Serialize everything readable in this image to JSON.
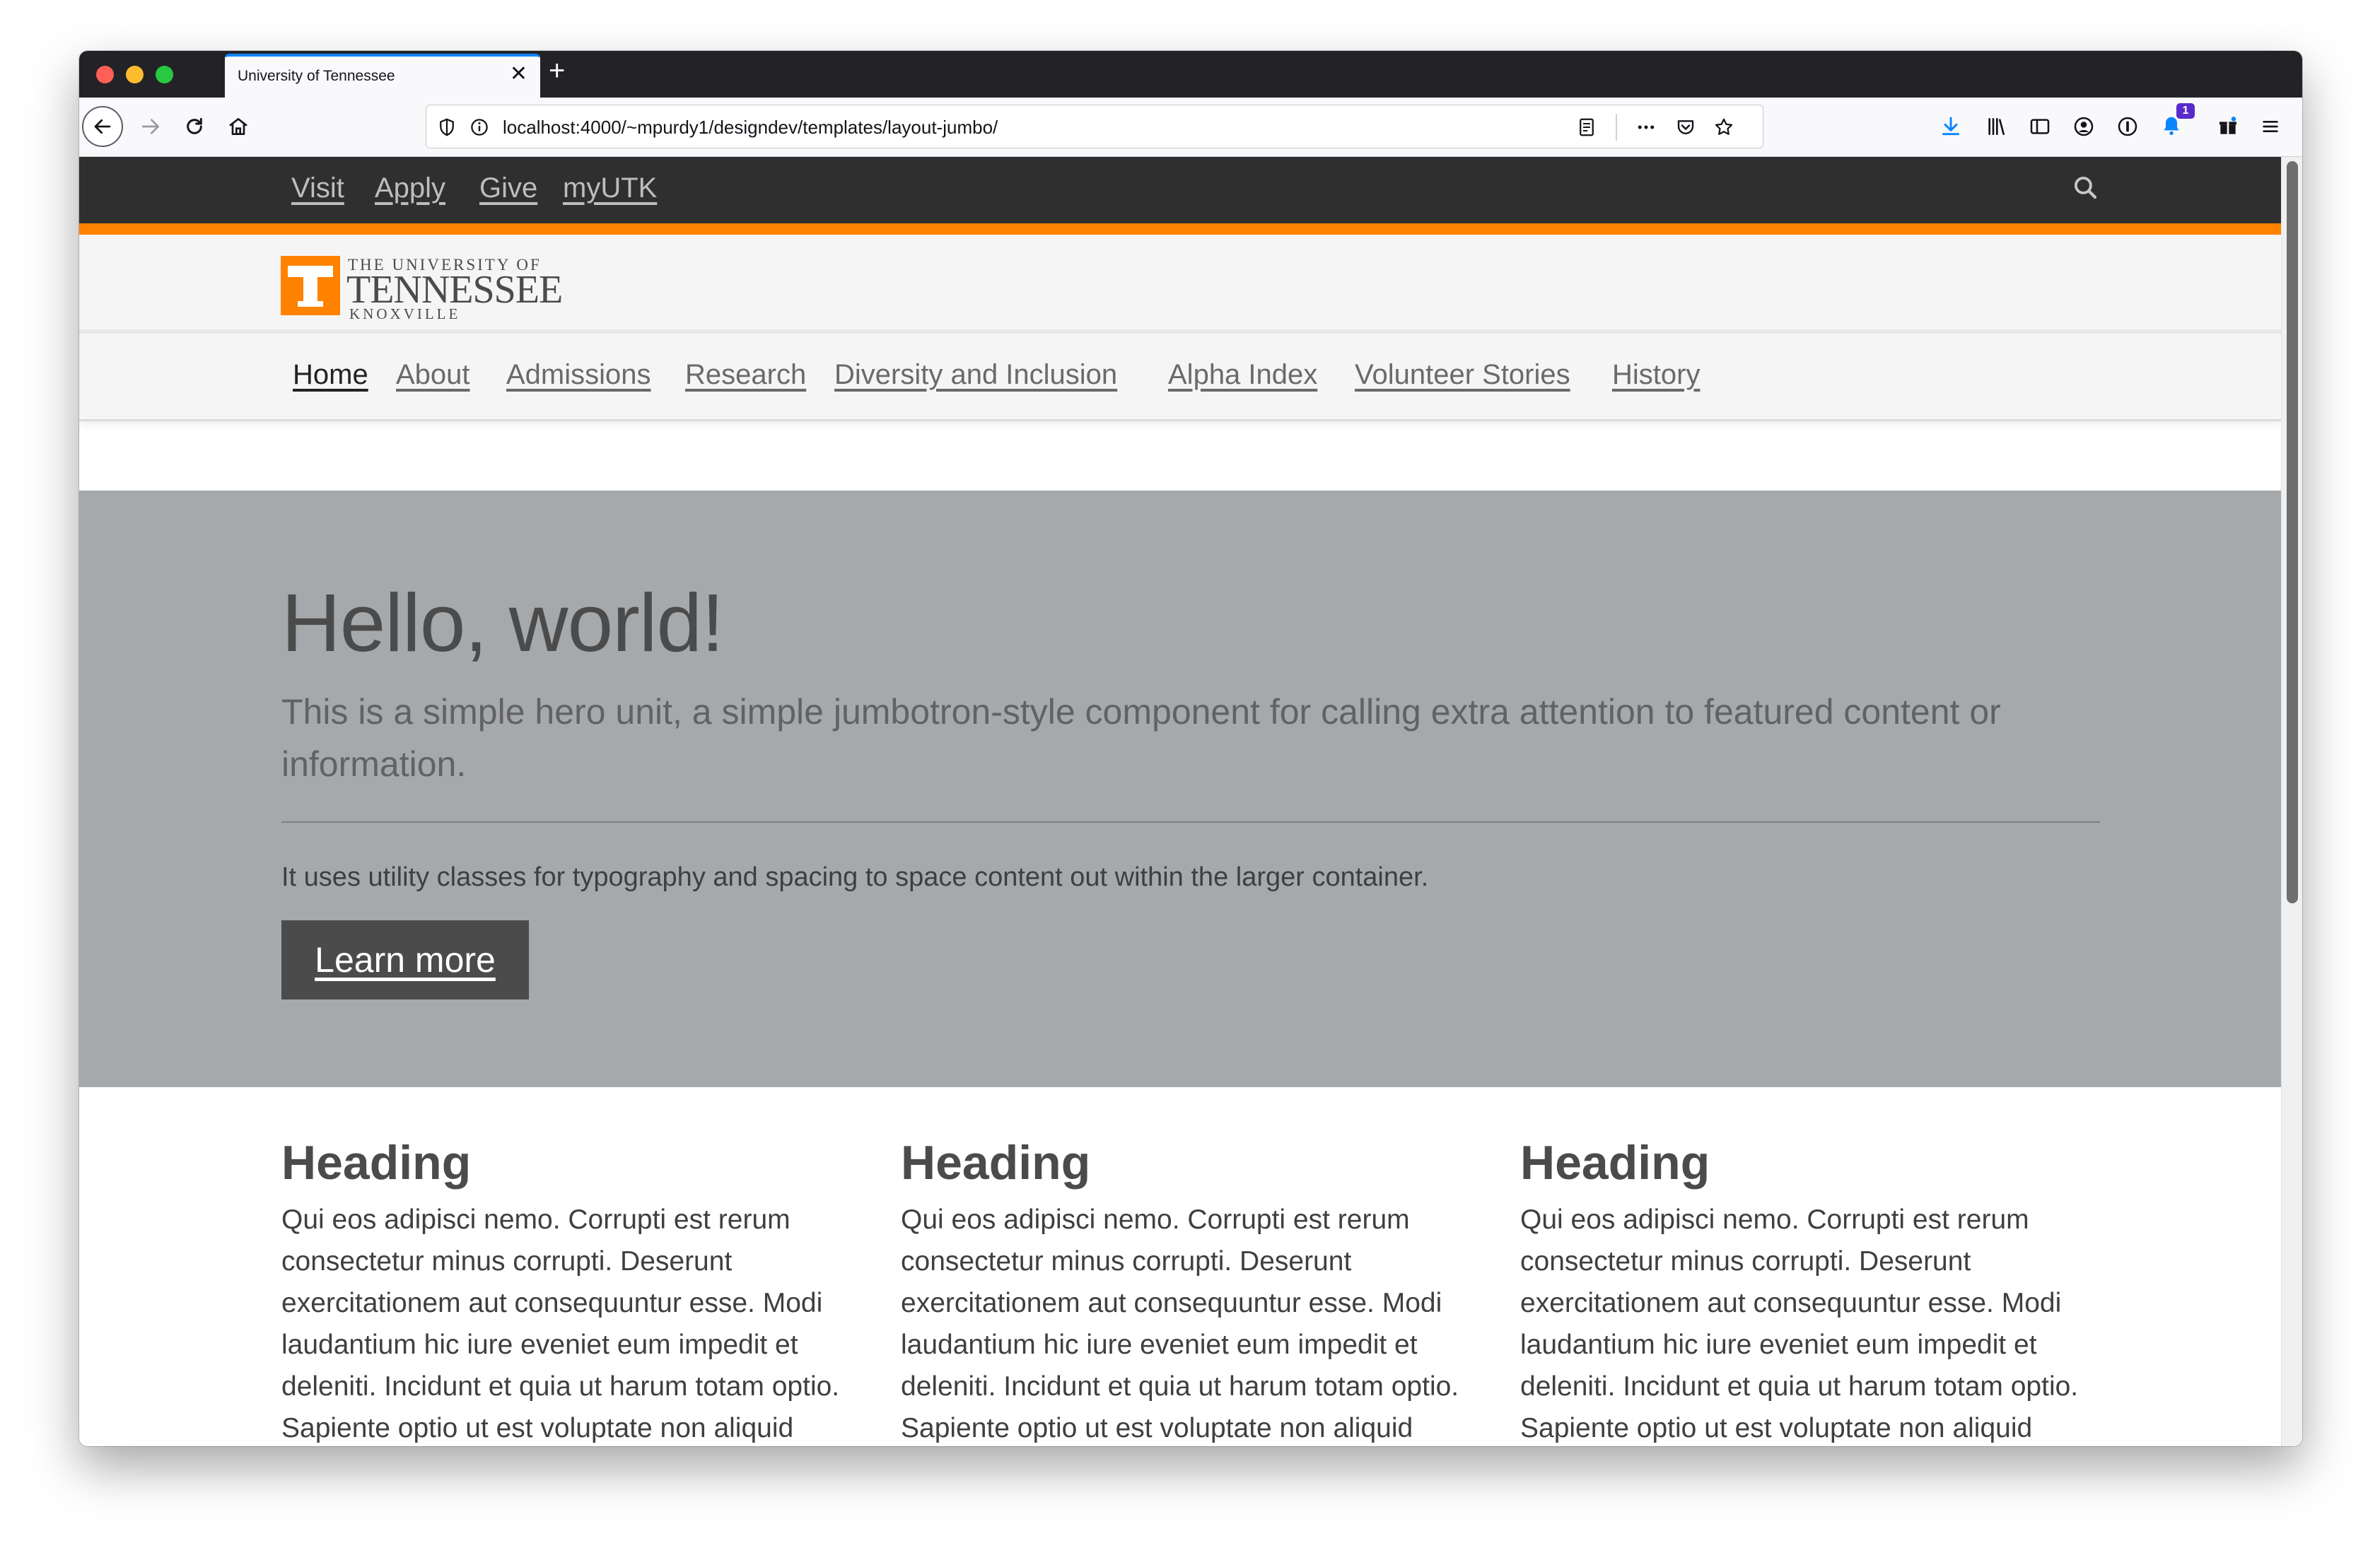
{
  "browser": {
    "tab_title": "University of Tennessee",
    "url": "localhost:4000/~mpurdy1/designdev/templates/layout-jumbo/",
    "notification_count": "1"
  },
  "utility_nav": {
    "items": [
      "Visit",
      "Apply",
      "Give",
      "myUTK"
    ]
  },
  "logo": {
    "line1": "THE UNIVERSITY OF",
    "line2": "TENNESSEE",
    "line3": "KNOXVILLE",
    "mark": "T"
  },
  "main_nav": {
    "items": [
      "Home",
      "About",
      "Admissions",
      "Research",
      "Diversity and Inclusion",
      "Alpha Index",
      "Volunteer Stories",
      "History"
    ],
    "active": "Home"
  },
  "hero": {
    "title": "Hello, world!",
    "lead": "This is a simple hero unit, a simple jumbotron-style component for calling extra attention to featured content or information.",
    "sub": "It uses utility classes for typography and spacing to space content out within the larger container.",
    "button": "Learn more"
  },
  "columns": [
    {
      "heading": "Heading",
      "body": "Qui eos adipisci nemo. Corrupti est rerum consectetur minus corrupti. Deserunt exercitationem aut consequuntur esse. Modi laudantium hic iure eveniet eum impedit et deleniti. Incidunt et quia ut harum totam optio. Sapiente optio ut est voluptate non aliquid quas."
    },
    {
      "heading": "Heading",
      "body": "Qui eos adipisci nemo. Corrupti est rerum consectetur minus corrupti. Deserunt exercitationem aut consequuntur esse. Modi laudantium hic iure eveniet eum impedit et deleniti. Incidunt et quia ut harum totam optio. Sapiente optio ut est voluptate non aliquid quas."
    },
    {
      "heading": "Heading",
      "body": "Qui eos adipisci nemo. Corrupti est rerum consectetur minus corrupti. Deserunt exercitationem aut consequuntur esse. Modi laudantium hic iure eveniet eum impedit et deleniti. Incidunt et quia ut harum totam optio. Sapiente optio ut est voluptate non aliquid quas."
    }
  ],
  "colors": {
    "ut_orange": "#ff8200",
    "utility_bar": "#2f2f2f",
    "hero_bg": "#a6a9ac",
    "button_bg": "#4b4b4b"
  }
}
